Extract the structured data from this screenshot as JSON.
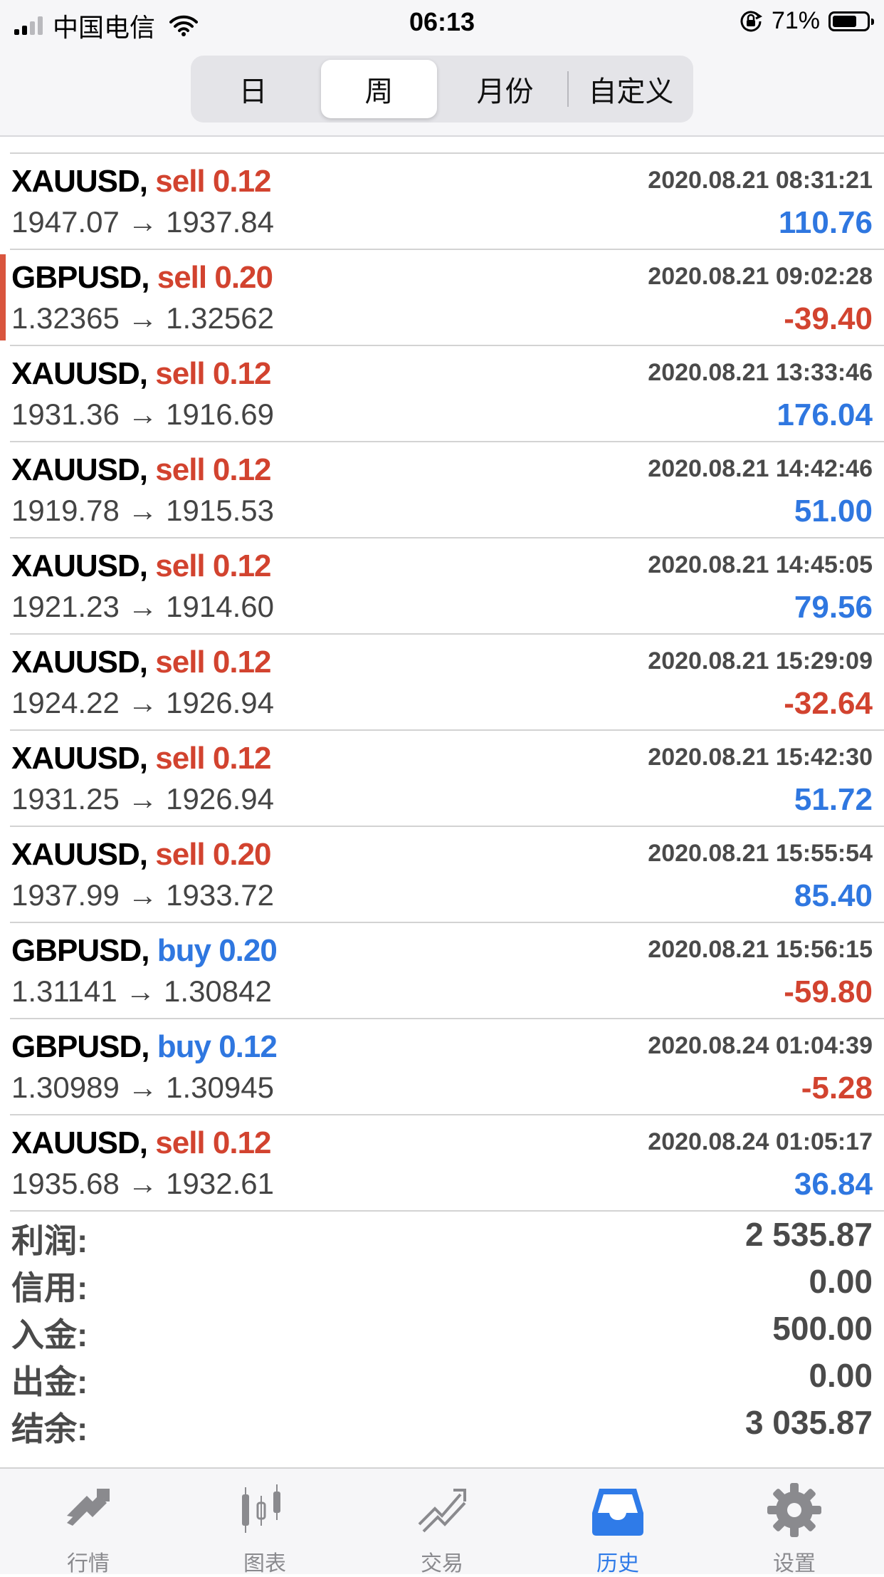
{
  "status_bar": {
    "carrier": "中国电信",
    "time": "06:13",
    "battery": "71%",
    "battery_level": 0.71
  },
  "period_tabs": [
    {
      "label": "日",
      "active": false
    },
    {
      "label": "周",
      "active": true
    },
    {
      "label": "月份",
      "active": false
    },
    {
      "label": "自定义",
      "active": false
    }
  ],
  "trades": [
    {
      "symbol": "XAUUSD,",
      "side": "sell",
      "volume": "0.12",
      "time": "2020.08.21 08:31:21",
      "prices": "1947.07 → 1937.84",
      "profit": "110.76",
      "profit_sign": "pos"
    },
    {
      "symbol": "GBPUSD,",
      "side": "sell",
      "volume": "0.20",
      "time": "2020.08.21 09:02:28",
      "prices": "1.32365 → 1.32562",
      "profit": "-39.40",
      "profit_sign": "neg",
      "marked": true
    },
    {
      "symbol": "XAUUSD,",
      "side": "sell",
      "volume": "0.12",
      "time": "2020.08.21 13:33:46",
      "prices": "1931.36 → 1916.69",
      "profit": "176.04",
      "profit_sign": "pos"
    },
    {
      "symbol": "XAUUSD,",
      "side": "sell",
      "volume": "0.12",
      "time": "2020.08.21 14:42:46",
      "prices": "1919.78 → 1915.53",
      "profit": "51.00",
      "profit_sign": "pos"
    },
    {
      "symbol": "XAUUSD,",
      "side": "sell",
      "volume": "0.12",
      "time": "2020.08.21 14:45:05",
      "prices": "1921.23 → 1914.60",
      "profit": "79.56",
      "profit_sign": "pos"
    },
    {
      "symbol": "XAUUSD,",
      "side": "sell",
      "volume": "0.12",
      "time": "2020.08.21 15:29:09",
      "prices": "1924.22 → 1926.94",
      "profit": "-32.64",
      "profit_sign": "neg"
    },
    {
      "symbol": "XAUUSD,",
      "side": "sell",
      "volume": "0.12",
      "time": "2020.08.21 15:42:30",
      "prices": "1931.25 → 1926.94",
      "profit": "51.72",
      "profit_sign": "pos"
    },
    {
      "symbol": "XAUUSD,",
      "side": "sell",
      "volume": "0.20",
      "time": "2020.08.21 15:55:54",
      "prices": "1937.99 → 1933.72",
      "profit": "85.40",
      "profit_sign": "pos"
    },
    {
      "symbol": "GBPUSD,",
      "side": "buy",
      "volume": "0.20",
      "time": "2020.08.21 15:56:15",
      "prices": "1.31141 → 1.30842",
      "profit": "-59.80",
      "profit_sign": "neg"
    },
    {
      "symbol": "GBPUSD,",
      "side": "buy",
      "volume": "0.12",
      "time": "2020.08.24 01:04:39",
      "prices": "1.30989 → 1.30945",
      "profit": "-5.28",
      "profit_sign": "neg"
    },
    {
      "symbol": "XAUUSD,",
      "side": "sell",
      "volume": "0.12",
      "time": "2020.08.24 01:05:17",
      "prices": "1935.68 → 1932.61",
      "profit": "36.84",
      "profit_sign": "pos"
    }
  ],
  "summary": [
    {
      "label": "利润:",
      "value": "2 535.87"
    },
    {
      "label": "信用:",
      "value": "0.00"
    },
    {
      "label": "入金:",
      "value": "500.00"
    },
    {
      "label": "出金:",
      "value": "0.00"
    },
    {
      "label": "结余:",
      "value": "3 035.87"
    }
  ],
  "tab_bar": [
    {
      "label": "行情",
      "icon": "quotes-icon",
      "active": false
    },
    {
      "label": "图表",
      "icon": "chart-icon",
      "active": false
    },
    {
      "label": "交易",
      "icon": "trade-icon",
      "active": false
    },
    {
      "label": "历史",
      "icon": "history-icon",
      "active": true
    },
    {
      "label": "设置",
      "icon": "settings-icon",
      "active": false
    }
  ],
  "colors": {
    "sell": "#d2432f",
    "buy": "#2f77e0",
    "profit_positive": "#2f77e0",
    "profit_negative": "#d2432f",
    "active_tab": "#2f7be8",
    "inactive_tab": "#8a8a8e"
  }
}
